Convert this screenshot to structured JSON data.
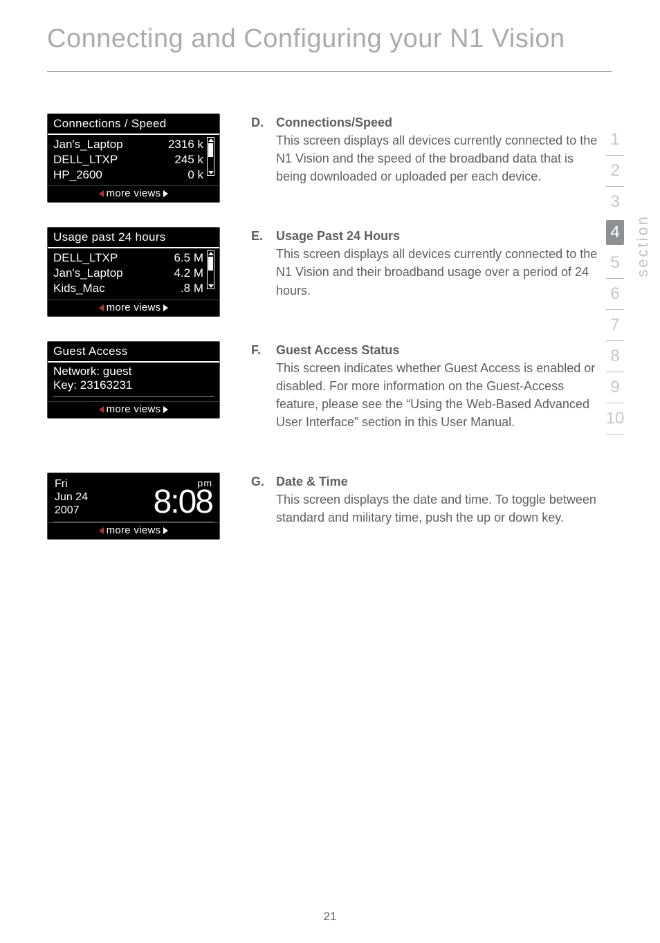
{
  "page": {
    "title": "Connecting and Configuring your N1 Vision",
    "number": "21",
    "section_label": "section"
  },
  "sidebar": {
    "items": [
      "1",
      "2",
      "3",
      "4",
      "5",
      "6",
      "7",
      "8",
      "9",
      "10"
    ],
    "active_index": 3
  },
  "panels": {
    "connections": {
      "header": "Connections / Speed",
      "rows": [
        {
          "name": "Jan's_Laptop",
          "value": "2316 k"
        },
        {
          "name": "DELL_LTXP",
          "value": "245 k"
        },
        {
          "name": "HP_2600",
          "value": "0 k"
        }
      ],
      "footer": "more views"
    },
    "usage": {
      "header": "Usage past 24 hours",
      "rows": [
        {
          "name": "DELL_LTXP",
          "value": "6.5 M"
        },
        {
          "name": "Jan's_Laptop",
          "value": "4.2 M"
        },
        {
          "name": "Kids_Mac",
          "value": ".8 M"
        }
      ],
      "footer": "more views"
    },
    "guest": {
      "header": "Guest Access",
      "network_label": "Network: guest",
      "key_label": "Key: 23163231",
      "footer": "more views"
    },
    "clock": {
      "day": "Fri",
      "date": "Jun 24",
      "year": "2007",
      "ampm": "pm",
      "time": "8:08",
      "footer": "more views"
    }
  },
  "descriptions": {
    "d": {
      "letter": "D.",
      "heading": "Connections/Speed",
      "body": "This screen displays all devices currently connected to the N1 Vision and the speed of the broadband data that is being downloaded or uploaded per each device."
    },
    "e": {
      "letter": "E.",
      "heading": "Usage Past 24 Hours",
      "body": "This screen displays all devices currently connected to the N1 Vision and their broadband usage over a period of 24 hours."
    },
    "f": {
      "letter": "F.",
      "heading": "Guest Access Status",
      "body": "This screen indicates whether Guest Access is enabled or disabled. For more information on the Guest-Access feature, please see the “Using the Web-Based Advanced User Interface” section in this User Manual."
    },
    "g": {
      "letter": "G.",
      "heading": "Date & Time",
      "body": "This screen displays the date and time. To toggle between standard and military time, push the up or down key."
    }
  }
}
